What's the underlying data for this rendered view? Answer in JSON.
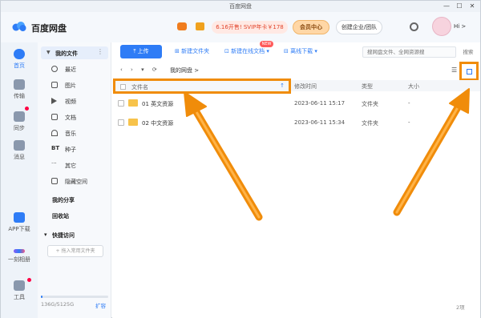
{
  "window": {
    "title": "百度网盘",
    "minimize": "—",
    "maximize": "☐",
    "close": "✕"
  },
  "header": {
    "logo_text": "百度网盘",
    "promo_text": "6.16开售! SVIP年卡￥178",
    "vip_center": "会员中心",
    "enterprise": "创建企业/团队",
    "greeting": "Hi >"
  },
  "rail": {
    "items": [
      {
        "label": "首页",
        "icon": "home-icon"
      },
      {
        "label": "传输",
        "icon": "transfer-icon"
      },
      {
        "label": "同步",
        "icon": "sync-icon"
      },
      {
        "label": "消息",
        "icon": "message-icon"
      },
      {
        "label": "APP下载",
        "icon": "phone-icon"
      },
      {
        "label": "一刻相册",
        "icon": "album-icon"
      },
      {
        "label": "工具",
        "icon": "tools-icon"
      }
    ]
  },
  "nav": {
    "head": "我的文件",
    "items": [
      {
        "label": "最近"
      },
      {
        "label": "图片"
      },
      {
        "label": "视频"
      },
      {
        "label": "文档"
      },
      {
        "label": "音乐"
      },
      {
        "label": "种子"
      },
      {
        "label": "其它"
      },
      {
        "label": "隐藏空间"
      }
    ],
    "my_share": "我的分享",
    "recycle": "回收站",
    "quick_access": "快捷访问",
    "add_quick": "+ 拖入常用文件夹",
    "storage_text": "136G/5125G",
    "storage_fraction": 0.027,
    "expand": "扩容"
  },
  "toolbar": {
    "upload": "上传",
    "new_folder": "新建文件夹",
    "new_online_doc": "新建在线文档",
    "new_badge": "NEW",
    "offline_download": "离线下载",
    "search_placeholder": "搜网盘文件、全网资源搜",
    "search_btn": "搜索"
  },
  "breadcrumb": {
    "current": "我的网盘",
    "separator": ">"
  },
  "table": {
    "headers": {
      "name": "文件名",
      "time": "修改时间",
      "type": "类型",
      "size": "大小"
    },
    "rows": [
      {
        "name": "01 英文资源",
        "time": "2023-06-11 15:17",
        "type": "文件夹",
        "size": "-"
      },
      {
        "name": "02 中文资源",
        "time": "2023-06-11 15:34",
        "type": "文件夹",
        "size": "-"
      }
    ]
  },
  "footer": {
    "count": "2项"
  },
  "colors": {
    "accent": "#2e7cf6",
    "highlight": "#f08c0a",
    "folder": "#f7c34b"
  }
}
